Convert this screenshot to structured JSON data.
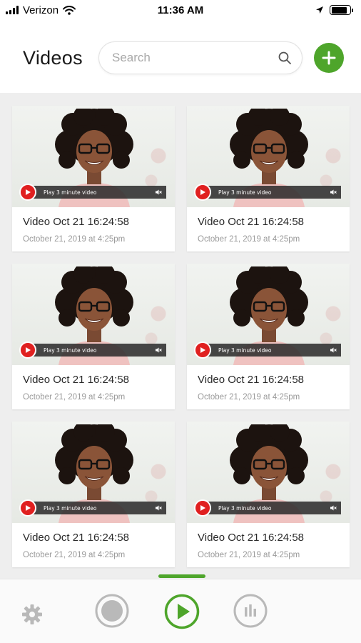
{
  "status_bar": {
    "carrier": "Verizon",
    "time": "11:36 AM",
    "battery_level": 0.85
  },
  "header": {
    "title": "Videos",
    "search_placeholder": "Search",
    "search_value": ""
  },
  "icons": {
    "search": "search-icon",
    "add": "plus-icon",
    "settings": "gear-icon",
    "record": "record-icon",
    "play": "play-icon",
    "stats": "bar-chart-icon"
  },
  "colors": {
    "accent": "#4ea52b",
    "play_red": "#e02020",
    "tab_gray": "#b9b9b9"
  },
  "videos": [
    {
      "title": "Video Oct 21 16:24:58",
      "date": "October 21, 2019 at 4:25pm",
      "overlay_label": "Play 3 minute video"
    },
    {
      "title": "Video Oct 21 16:24:58",
      "date": "October 21, 2019 at 4:25pm",
      "overlay_label": "Play 3 minute video"
    },
    {
      "title": "Video Oct 21 16:24:58",
      "date": "October 21, 2019 at 4:25pm",
      "overlay_label": "Play 3 minute video"
    },
    {
      "title": "Video Oct 21 16:24:58",
      "date": "October 21, 2019 at 4:25pm",
      "overlay_label": "Play 3 minute video"
    },
    {
      "title": "Video Oct 21 16:24:58",
      "date": "October 21, 2019 at 4:25pm",
      "overlay_label": "Play 3 minute video"
    },
    {
      "title": "Video Oct 21 16:24:58",
      "date": "October 21, 2019 at 4:25pm",
      "overlay_label": "Play 3 minute video"
    }
  ],
  "tabbar": {
    "active_tab": "videos"
  }
}
